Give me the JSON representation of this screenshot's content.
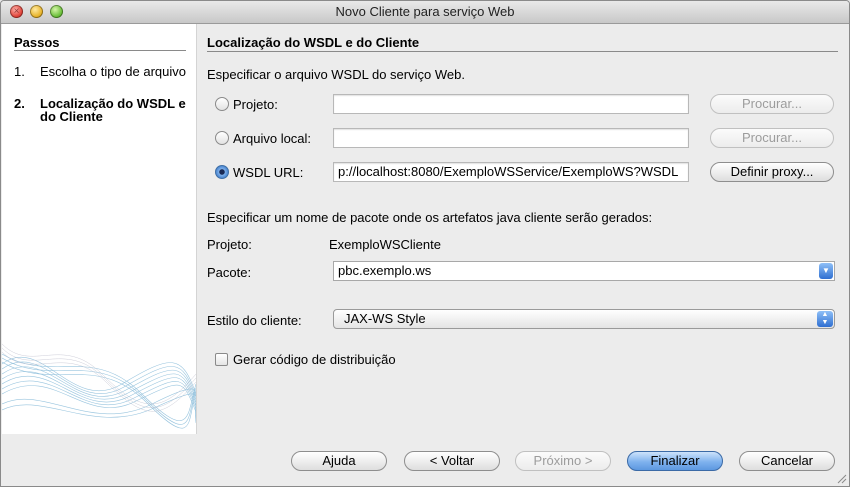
{
  "window": {
    "title": "Novo Cliente para serviço Web"
  },
  "steps": {
    "title": "Passos",
    "items": [
      {
        "num": "1.",
        "label": "Escolha o tipo de arquivo"
      },
      {
        "num": "2.",
        "label": "Localização do WSDL e do Cliente"
      }
    ]
  },
  "main": {
    "title": "Localização do WSDL e do Cliente",
    "wsdl_prompt": "Especificar o arquivo WSDL do serviço Web.",
    "source_options": [
      {
        "label": "Projeto:",
        "value": "",
        "button": "Procurar...",
        "selected": false
      },
      {
        "label": "Arquivo local:",
        "value": "",
        "button": "Procurar...",
        "selected": false
      },
      {
        "label": "WSDL URL:",
        "value": "p://localhost:8080/ExemploWSService/ExemploWS?WSDL",
        "button": "Definir proxy...",
        "selected": true
      }
    ],
    "package_prompt": "Especificar um nome de pacote onde os artefatos java cliente serão gerados:",
    "project_label": "Projeto:",
    "project_value": "ExemploWSCliente",
    "package_label": "Pacote:",
    "package_value": "pbc.exemplo.ws",
    "style_label": "Estilo do cliente:",
    "style_value": "JAX-WS Style",
    "dispatch_label": "Gerar código de distribuição",
    "dispatch_checked": false
  },
  "footer": {
    "help": "Ajuda",
    "back": "< Voltar",
    "next": "Próximo >",
    "finish": "Finalizar",
    "cancel": "Cancelar"
  },
  "colors": {
    "default_button": "#6fa6ea",
    "radio_selected": "#3c79c9"
  }
}
